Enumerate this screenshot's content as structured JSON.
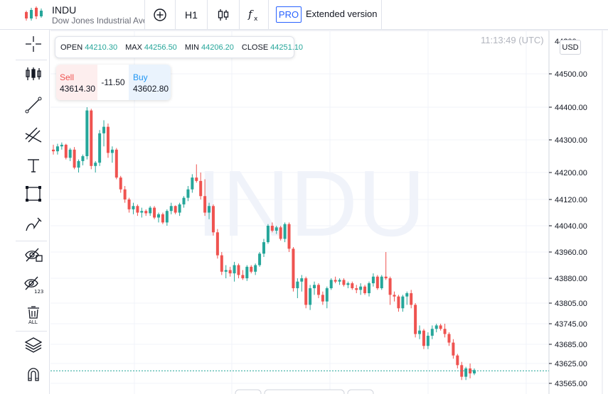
{
  "header": {
    "symbol": "INDU",
    "description": "Dow Jones Industrial Ave",
    "timeframe": "H1",
    "pro_label": "PRO",
    "extended_label": "Extended version"
  },
  "toolbar": {
    "tools": [
      "crosshair-icon",
      "candles-indicator-icon",
      "trend-line-icon",
      "fib-channel-icon",
      "text-icon",
      "rectangle-icon",
      "brush-icon",
      "hide-drawings-icon",
      "hide-indicators-icon",
      "remove-all-icon",
      "layers-icon",
      "magnet-icon"
    ]
  },
  "ohlc": {
    "open_label": "OPEN",
    "open": "44210.30",
    "max_label": "MAX",
    "max": "44256.50",
    "min_label": "MIN",
    "min": "44206.20",
    "close_label": "CLOSE",
    "close": "44251.10"
  },
  "trade": {
    "sell_label": "Sell",
    "sell_price": "43614.30",
    "spread": "-11.50",
    "buy_label": "Buy",
    "buy_price": "43602.80"
  },
  "clock": "11:13:49 (UTC)",
  "currency": "USD",
  "colors": {
    "up": "#26a69a",
    "down": "#ef5350",
    "accent": "#2962ff",
    "watermark": "#f0f3fa"
  },
  "chart_data": {
    "type": "candlestick",
    "symbol": "INDU",
    "watermark": "INDU",
    "y_ticks": [
      "44500.00",
      "44400.00",
      "44300.00",
      "44200.00",
      "44120.00",
      "44040.00",
      "43960.00",
      "43880.00",
      "43805.00",
      "43745.00",
      "43685.00",
      "43625.00",
      "43565.00"
    ],
    "y_tick_values": [
      44500,
      44400,
      44300,
      44200,
      44120,
      44040,
      43960,
      43880,
      43805,
      43745,
      43685,
      43625,
      43565
    ],
    "top_label_partial": "44?00",
    "ylim": [
      43548,
      44625
    ],
    "current_price": 43602.8,
    "candles": [
      [
        44270,
        44285,
        44255,
        44265
      ],
      [
        44265,
        44288,
        44255,
        44280
      ],
      [
        44280,
        44292,
        44270,
        44285
      ],
      [
        44285,
        44288,
        44240,
        44245
      ],
      [
        44245,
        44275,
        44235,
        44270
      ],
      [
        44270,
        44278,
        44210,
        44215
      ],
      [
        44215,
        44240,
        44200,
        44235
      ],
      [
        44235,
        44255,
        44222,
        44250
      ],
      [
        44250,
        44400,
        44240,
        44390
      ],
      [
        44390,
        44395,
        44210,
        44220
      ],
      [
        44220,
        44235,
        44200,
        44230
      ],
      [
        44230,
        44330,
        44220,
        44320
      ],
      [
        44320,
        44360,
        44280,
        44340
      ],
      [
        44340,
        44350,
        44245,
        44260
      ],
      [
        44260,
        44280,
        44230,
        44270
      ],
      [
        44270,
        44275,
        44180,
        44185
      ],
      [
        44185,
        44190,
        44140,
        44150
      ],
      [
        44150,
        44160,
        44110,
        44120
      ],
      [
        44120,
        44125,
        44080,
        44090
      ],
      [
        44090,
        44110,
        44075,
        44100
      ],
      [
        44100,
        44105,
        44070,
        44080
      ],
      [
        44080,
        44095,
        44065,
        44085
      ],
      [
        44085,
        44090,
        44070,
        44078
      ],
      [
        44078,
        44100,
        44070,
        44095
      ],
      [
        44095,
        44100,
        44060,
        44065
      ],
      [
        44065,
        44080,
        44050,
        44075
      ],
      [
        44075,
        44080,
        44045,
        44050
      ],
      [
        44050,
        44090,
        44040,
        44085
      ],
      [
        44085,
        44110,
        44075,
        44100
      ],
      [
        44100,
        44102,
        44075,
        44080
      ],
      [
        44080,
        44110,
        44070,
        44105
      ],
      [
        44105,
        44130,
        44095,
        44125
      ],
      [
        44125,
        44160,
        44115,
        44150
      ],
      [
        44150,
        44195,
        44140,
        44185
      ],
      [
        44185,
        44225,
        44170,
        44175
      ],
      [
        44175,
        44200,
        44120,
        44130
      ],
      [
        44130,
        44180,
        44070,
        44080
      ],
      [
        44080,
        44110,
        44060,
        44100
      ],
      [
        44100,
        44105,
        44010,
        44020
      ],
      [
        44020,
        44030,
        43940,
        43950
      ],
      [
        43950,
        43960,
        43890,
        43900
      ],
      [
        43900,
        43920,
        43880,
        43905
      ],
      [
        43905,
        43915,
        43885,
        43895
      ],
      [
        43895,
        43930,
        43870,
        43920
      ],
      [
        43920,
        43925,
        43880,
        43890
      ],
      [
        43890,
        43905,
        43875,
        43880
      ],
      [
        43880,
        43920,
        43872,
        43915
      ],
      [
        43915,
        43920,
        43895,
        43900
      ],
      [
        43900,
        43925,
        43890,
        43920
      ],
      [
        43920,
        43960,
        43915,
        43955
      ],
      [
        43955,
        44000,
        43945,
        43990
      ],
      [
        43990,
        44045,
        43985,
        44040
      ],
      [
        44040,
        44050,
        44020,
        44025
      ],
      [
        44025,
        44040,
        44015,
        44035
      ],
      [
        44035,
        44040,
        43995,
        44000
      ],
      [
        44000,
        44050,
        43990,
        44045
      ],
      [
        44045,
        44050,
        43960,
        43970
      ],
      [
        43970,
        43975,
        43840,
        43850
      ],
      [
        43850,
        43880,
        43820,
        43870
      ],
      [
        43870,
        43890,
        43840,
        43880
      ],
      [
        43880,
        43885,
        43790,
        43800
      ],
      [
        43800,
        43860,
        43785,
        43850
      ],
      [
        43850,
        43870,
        43830,
        43860
      ],
      [
        43860,
        43865,
        43820,
        43830
      ],
      [
        43830,
        43840,
        43800,
        43810
      ],
      [
        43810,
        43855,
        43790,
        43850
      ],
      [
        43850,
        43880,
        43845,
        43875
      ],
      [
        43875,
        43885,
        43865,
        43870
      ],
      [
        43870,
        43880,
        43860,
        43875
      ],
      [
        43875,
        43880,
        43855,
        43860
      ],
      [
        43860,
        43870,
        43850,
        43865
      ],
      [
        43865,
        43870,
        43845,
        43850
      ],
      [
        43850,
        43860,
        43835,
        43845
      ],
      [
        43845,
        43865,
        43830,
        43855
      ],
      [
        43855,
        43860,
        43830,
        43835
      ],
      [
        43835,
        43870,
        43825,
        43865
      ],
      [
        43865,
        43895,
        43855,
        43885
      ],
      [
        43885,
        43890,
        43845,
        43850
      ],
      [
        43850,
        43890,
        43845,
        43885
      ],
      [
        43885,
        43960,
        43875,
        43880
      ],
      [
        43880,
        43885,
        43800,
        43830
      ],
      [
        43830,
        43840,
        43810,
        43825
      ],
      [
        43825,
        43830,
        43780,
        43790
      ],
      [
        43790,
        43830,
        43780,
        43825
      ],
      [
        43825,
        43840,
        43800,
        43835
      ],
      [
        43835,
        43845,
        43790,
        43800
      ],
      [
        43800,
        43805,
        43705,
        43715
      ],
      [
        43715,
        43740,
        43700,
        43725
      ],
      [
        43725,
        43730,
        43670,
        43680
      ],
      [
        43680,
        43720,
        43670,
        43710
      ],
      [
        43710,
        43740,
        43700,
        43730
      ],
      [
        43730,
        43745,
        43720,
        43740
      ],
      [
        43740,
        43745,
        43725,
        43730
      ],
      [
        43730,
        43745,
        43705,
        43715
      ],
      [
        43715,
        43720,
        43680,
        43690
      ],
      [
        43690,
        43700,
        43640,
        43650
      ],
      [
        43650,
        43655,
        43610,
        43620
      ],
      [
        43620,
        43630,
        43575,
        43585
      ],
      [
        43585,
        43615,
        43575,
        43610
      ],
      [
        43610,
        43625,
        43580,
        43595
      ],
      [
        43595,
        43610,
        43590,
        43605
      ]
    ]
  }
}
